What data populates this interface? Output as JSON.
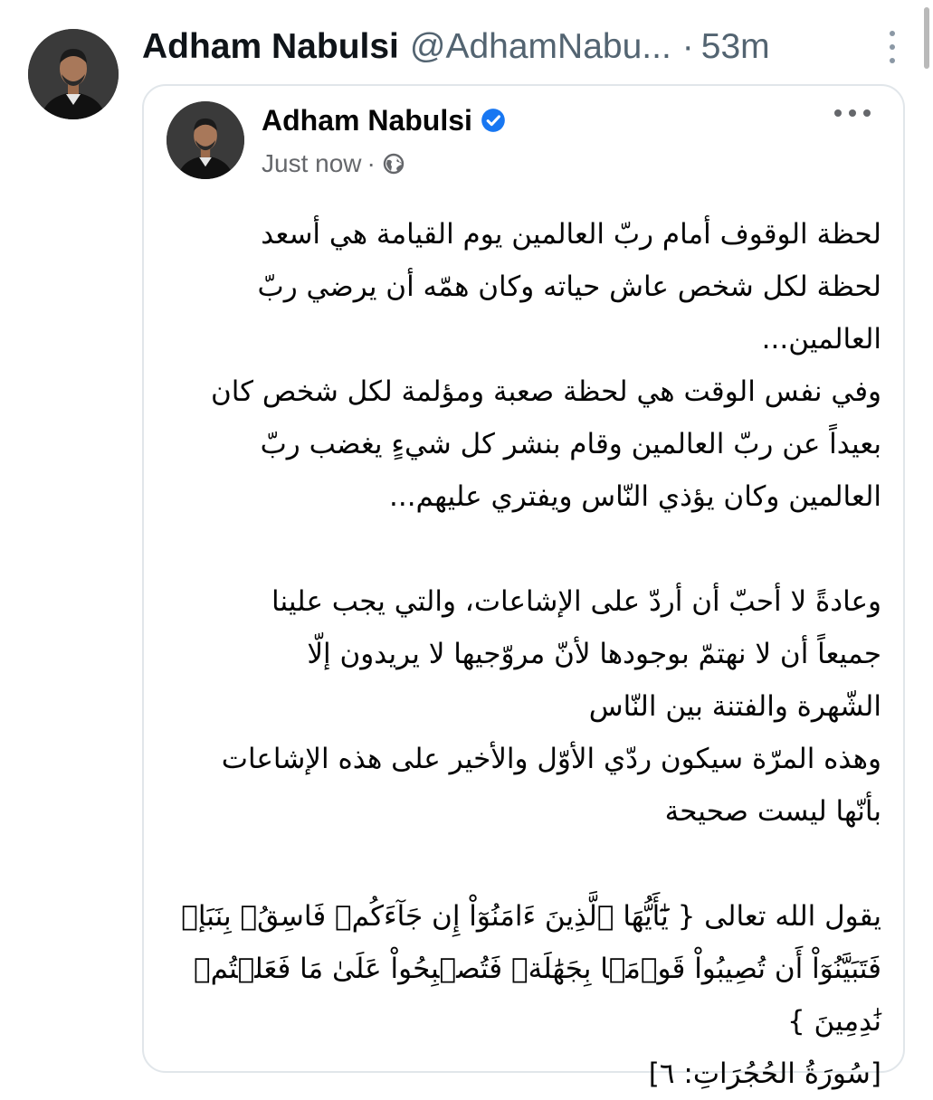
{
  "tweet": {
    "author_name": "Adham Nabulsi",
    "handle": "@AdhamNabu...",
    "separator": "·",
    "time": "53m",
    "avatar_icon": "profile-photo",
    "more_icon": "more-vertical-icon"
  },
  "facebook_post": {
    "author_name": "Adham Nabulsi",
    "verified_icon": "verified-badge-icon",
    "verified_color": "#1877f2",
    "time": "Just now",
    "separator": "·",
    "audience_icon": "globe-icon",
    "more_icon": "more-horizontal-icon",
    "lines": [
      "لحظة الوقوف أمام ربّ العالمين يوم القيامة هي أسعد",
      "لحظة لكل شخص عاش حياته وكان همّه أن يرضي ربّ",
      "العالمين...",
      "وفي نفس الوقت هي لحظة صعبة ومؤلمة لكل شخص كان",
      "بعيداً عن ربّ العالمين وقام بنشر كل شيءٍ يغضب ربّ",
      "العالمين وكان يؤذي النّاس ويفتري عليهم...",
      "",
      "وعادةً لا أحبّ أن أردّ على الإشاعات، والتي يجب علينا",
      "جميعاً أن لا نهتمّ بوجودها لأنّ مروّجيها لا يريدون إلّا",
      "الشّهرة والفتنة بين النّاس",
      "وهذه المرّة سيكون ردّي الأوّل والأخير على هذه الإشاعات",
      "بأنّها ليست صحيحة",
      "",
      "يقول الله تعالى { يَٰٓأَيُّهَا ٱلَّذِينَ ءَامَنُوٓاْ إِن جَآءَكُمۡ فَاسِقُۢ بِنَبَإٖ",
      "فَتَبَيَّنُوٓاْ أَن تُصِيبُواْ قَوۡمَۢا بِجَهَٰلَةٖ فَتُصۡبِحُواْ عَلَىٰ مَا فَعَلۡتُمۡ",
      "نَٰدِمِينَ }",
      "[سُورَةُ الحُجُرَاتِ: ٦]"
    ]
  }
}
